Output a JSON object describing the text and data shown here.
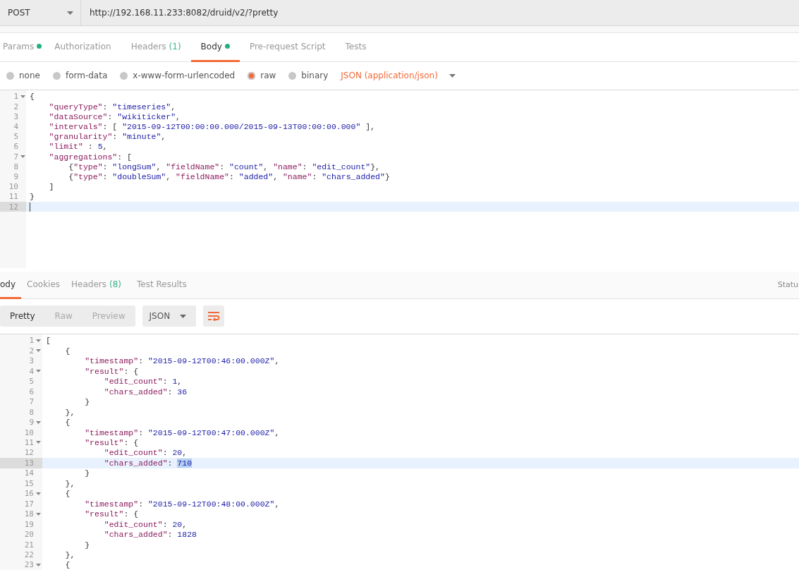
{
  "request_bar": {
    "method": "POST",
    "url": "http://192.168.11.233:8082/druid/v2/?pretty"
  },
  "request_tabs": [
    {
      "label": "Params",
      "dot": true,
      "selected": false
    },
    {
      "label": "Authorization",
      "dot": false,
      "selected": false
    },
    {
      "label": "Headers",
      "count": "(1)",
      "dot": false,
      "selected": false
    },
    {
      "label": "Body",
      "dot": true,
      "selected": true
    },
    {
      "label": "Pre-request Script",
      "dot": false,
      "selected": false
    },
    {
      "label": "Tests",
      "dot": false,
      "selected": false
    }
  ],
  "body_types": [
    {
      "label": "none",
      "selected": false
    },
    {
      "label": "form-data",
      "selected": false
    },
    {
      "label": "x-www-form-urlencoded",
      "selected": false
    },
    {
      "label": "raw",
      "selected": true
    },
    {
      "label": "binary",
      "selected": false
    }
  ],
  "content_type": "JSON (application/json)",
  "request_editor": [
    {
      "number": "1",
      "fold": true,
      "active": false,
      "tokens": [
        {
          "kind": "p",
          "text": "{"
        }
      ]
    },
    {
      "number": "2",
      "fold": false,
      "active": false,
      "tokens": [
        {
          "kind": "k",
          "text": "    \"queryType\""
        },
        {
          "kind": "p",
          "text": ": "
        },
        {
          "kind": "s",
          "text": "\"timeseries\""
        },
        {
          "kind": "p",
          "text": ","
        }
      ]
    },
    {
      "number": "3",
      "fold": false,
      "active": false,
      "tokens": [
        {
          "kind": "k",
          "text": "    \"dataSource\""
        },
        {
          "kind": "p",
          "text": ": "
        },
        {
          "kind": "s",
          "text": "\"wikiticker\""
        },
        {
          "kind": "p",
          "text": ","
        }
      ]
    },
    {
      "number": "4",
      "fold": false,
      "active": false,
      "tokens": [
        {
          "kind": "k",
          "text": "    \"intervals\""
        },
        {
          "kind": "p",
          "text": ": [ "
        },
        {
          "kind": "s",
          "text": "\"2015-09-12T00:00:00.000/2015-09-13T00:00:00.000\""
        },
        {
          "kind": "p",
          "text": " ],"
        }
      ]
    },
    {
      "number": "5",
      "fold": false,
      "active": false,
      "tokens": [
        {
          "kind": "k",
          "text": "    \"granularity\""
        },
        {
          "kind": "p",
          "text": ": "
        },
        {
          "kind": "s",
          "text": "\"minute\""
        },
        {
          "kind": "p",
          "text": ","
        }
      ]
    },
    {
      "number": "6",
      "fold": false,
      "active": false,
      "tokens": [
        {
          "kind": "k",
          "text": "    \"limit\""
        },
        {
          "kind": "p",
          "text": " : "
        },
        {
          "kind": "n",
          "text": "5"
        },
        {
          "kind": "p",
          "text": ","
        }
      ]
    },
    {
      "number": "7",
      "fold": true,
      "active": false,
      "tokens": [
        {
          "kind": "k",
          "text": "    \"aggregations\""
        },
        {
          "kind": "p",
          "text": ": ["
        }
      ]
    },
    {
      "number": "8",
      "fold": false,
      "active": false,
      "tokens": [
        {
          "kind": "p",
          "text": "        {"
        },
        {
          "kind": "k",
          "text": "\"type\""
        },
        {
          "kind": "p",
          "text": ": "
        },
        {
          "kind": "s",
          "text": "\"longSum\""
        },
        {
          "kind": "p",
          "text": ", "
        },
        {
          "kind": "k",
          "text": "\"fieldName\""
        },
        {
          "kind": "p",
          "text": ": "
        },
        {
          "kind": "s",
          "text": "\"count\""
        },
        {
          "kind": "p",
          "text": ", "
        },
        {
          "kind": "k",
          "text": "\"name\""
        },
        {
          "kind": "p",
          "text": ": "
        },
        {
          "kind": "s",
          "text": "\"edit_count\""
        },
        {
          "kind": "p",
          "text": "},"
        }
      ]
    },
    {
      "number": "9",
      "fold": false,
      "active": false,
      "tokens": [
        {
          "kind": "p",
          "text": "        {"
        },
        {
          "kind": "k",
          "text": "\"type\""
        },
        {
          "kind": "p",
          "text": ": "
        },
        {
          "kind": "s",
          "text": "\"doubleSum\""
        },
        {
          "kind": "p",
          "text": ", "
        },
        {
          "kind": "k",
          "text": "\"fieldName\""
        },
        {
          "kind": "p",
          "text": ": "
        },
        {
          "kind": "s",
          "text": "\"added\""
        },
        {
          "kind": "p",
          "text": ", "
        },
        {
          "kind": "k",
          "text": "\"name\""
        },
        {
          "kind": "p",
          "text": ": "
        },
        {
          "kind": "s",
          "text": "\"chars_added\""
        },
        {
          "kind": "p",
          "text": "}"
        }
      ]
    },
    {
      "number": "10",
      "fold": false,
      "active": false,
      "tokens": [
        {
          "kind": "p",
          "text": "    ]"
        }
      ]
    },
    {
      "number": "11",
      "fold": false,
      "active": false,
      "tokens": [
        {
          "kind": "p",
          "text": "}"
        }
      ]
    },
    {
      "number": "12",
      "fold": false,
      "active": true
    }
  ],
  "response_tabs": [
    {
      "label": "ody",
      "selected": true
    },
    {
      "label": "Cookies",
      "selected": false
    },
    {
      "label": "Headers",
      "count": "(8)",
      "selected": false
    },
    {
      "label": "Test Results",
      "selected": false
    }
  ],
  "status_label": "Statu",
  "view_modes": [
    {
      "label": "Pretty",
      "selected": true
    },
    {
      "label": "Raw",
      "selected": false
    },
    {
      "label": "Preview",
      "selected": false
    }
  ],
  "format": "JSON",
  "response_editor": [
    {
      "number": "1",
      "fold": true,
      "active": false,
      "tokens": [
        {
          "kind": "p",
          "text": "["
        }
      ]
    },
    {
      "number": "2",
      "fold": true,
      "active": false,
      "tokens": [
        {
          "kind": "p",
          "text": "    {"
        }
      ]
    },
    {
      "number": "3",
      "fold": false,
      "active": false,
      "tokens": [
        {
          "kind": "k",
          "text": "        \"timestamp\""
        },
        {
          "kind": "p",
          "text": ": "
        },
        {
          "kind": "s",
          "text": "\"2015-09-12T00:46:00.000Z\""
        },
        {
          "kind": "p",
          "text": ","
        }
      ]
    },
    {
      "number": "4",
      "fold": true,
      "active": false,
      "tokens": [
        {
          "kind": "k",
          "text": "        \"result\""
        },
        {
          "kind": "p",
          "text": ": {"
        }
      ]
    },
    {
      "number": "5",
      "fold": false,
      "active": false,
      "tokens": [
        {
          "kind": "k",
          "text": "            \"edit_count\""
        },
        {
          "kind": "p",
          "text": ": "
        },
        {
          "kind": "n",
          "text": "1"
        },
        {
          "kind": "p",
          "text": ","
        }
      ]
    },
    {
      "number": "6",
      "fold": false,
      "active": false,
      "tokens": [
        {
          "kind": "k",
          "text": "            \"chars_added\""
        },
        {
          "kind": "p",
          "text": ": "
        },
        {
          "kind": "n",
          "text": "36"
        }
      ]
    },
    {
      "number": "7",
      "fold": false,
      "active": false,
      "tokens": [
        {
          "kind": "p",
          "text": "        }"
        }
      ]
    },
    {
      "number": "8",
      "fold": false,
      "active": false,
      "tokens": [
        {
          "kind": "p",
          "text": "    },"
        }
      ]
    },
    {
      "number": "9",
      "fold": true,
      "active": false,
      "tokens": [
        {
          "kind": "p",
          "text": "    {"
        }
      ]
    },
    {
      "number": "10",
      "fold": false,
      "active": false,
      "tokens": [
        {
          "kind": "k",
          "text": "        \"timestamp\""
        },
        {
          "kind": "p",
          "text": ": "
        },
        {
          "kind": "s",
          "text": "\"2015-09-12T00:47:00.000Z\""
        },
        {
          "kind": "p",
          "text": ","
        }
      ]
    },
    {
      "number": "11",
      "fold": true,
      "active": false,
      "tokens": [
        {
          "kind": "k",
          "text": "        \"result\""
        },
        {
          "kind": "p",
          "text": ": {"
        }
      ]
    },
    {
      "number": "12",
      "fold": false,
      "active": false,
      "tokens": [
        {
          "kind": "k",
          "text": "            \"edit_count\""
        },
        {
          "kind": "p",
          "text": ": "
        },
        {
          "kind": "n",
          "text": "20"
        },
        {
          "kind": "p",
          "text": ","
        }
      ]
    },
    {
      "number": "13",
      "fold": false,
      "active": true,
      "tokens": [
        {
          "kind": "k",
          "text": "            \"chars_added\""
        },
        {
          "kind": "p",
          "text": ": "
        },
        {
          "kind": "sel",
          "text": "710"
        }
      ]
    },
    {
      "number": "14",
      "fold": false,
      "active": false,
      "tokens": [
        {
          "kind": "p",
          "text": "        }"
        }
      ]
    },
    {
      "number": "15",
      "fold": false,
      "active": false,
      "tokens": [
        {
          "kind": "p",
          "text": "    },"
        }
      ]
    },
    {
      "number": "16",
      "fold": true,
      "active": false,
      "tokens": [
        {
          "kind": "p",
          "text": "    {"
        }
      ]
    },
    {
      "number": "17",
      "fold": false,
      "active": false,
      "tokens": [
        {
          "kind": "k",
          "text": "        \"timestamp\""
        },
        {
          "kind": "p",
          "text": ": "
        },
        {
          "kind": "s",
          "text": "\"2015-09-12T00:48:00.000Z\""
        },
        {
          "kind": "p",
          "text": ","
        }
      ]
    },
    {
      "number": "18",
      "fold": true,
      "active": false,
      "tokens": [
        {
          "kind": "k",
          "text": "        \"result\""
        },
        {
          "kind": "p",
          "text": ": {"
        }
      ]
    },
    {
      "number": "19",
      "fold": false,
      "active": false,
      "tokens": [
        {
          "kind": "k",
          "text": "            \"edit_count\""
        },
        {
          "kind": "p",
          "text": ": "
        },
        {
          "kind": "n",
          "text": "20"
        },
        {
          "kind": "p",
          "text": ","
        }
      ]
    },
    {
      "number": "20",
      "fold": false,
      "active": false,
      "tokens": [
        {
          "kind": "k",
          "text": "            \"chars_added\""
        },
        {
          "kind": "p",
          "text": ": "
        },
        {
          "kind": "n",
          "text": "1828"
        }
      ]
    },
    {
      "number": "21",
      "fold": false,
      "active": false,
      "tokens": [
        {
          "kind": "p",
          "text": "        }"
        }
      ]
    },
    {
      "number": "22",
      "fold": false,
      "active": false,
      "tokens": [
        {
          "kind": "p",
          "text": "    },"
        }
      ]
    },
    {
      "number": "23",
      "fold": true,
      "active": false,
      "tokens": [
        {
          "kind": "p",
          "text": "    {"
        }
      ]
    }
  ]
}
